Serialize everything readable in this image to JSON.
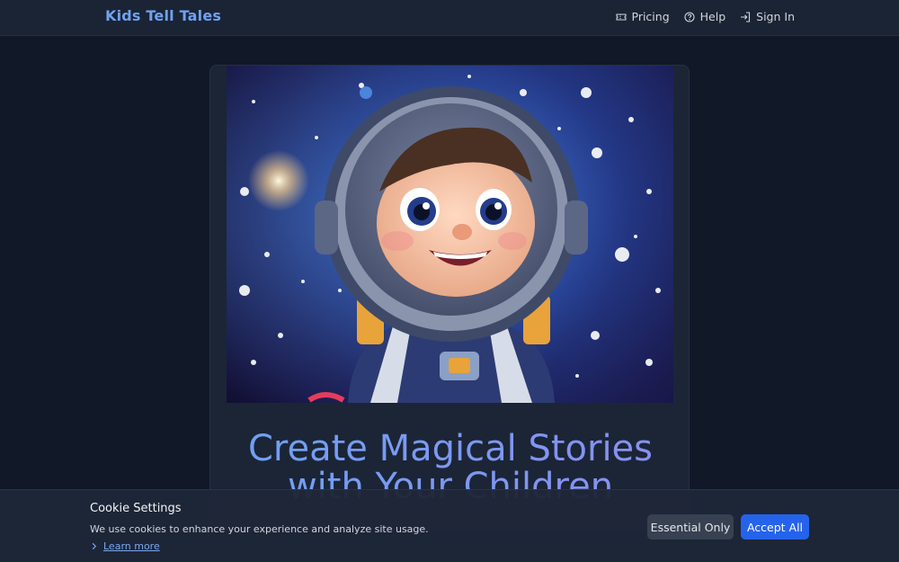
{
  "app": {
    "brand": "Kids Tell Tales"
  },
  "nav": {
    "items": [
      {
        "label": "Pricing",
        "icon": "ticket-icon"
      },
      {
        "label": "Help",
        "icon": "help-circle-icon"
      },
      {
        "label": "Sign In",
        "icon": "sign-in-icon"
      }
    ]
  },
  "hero": {
    "image_subject": "astronaut-child-in-space",
    "headline": "Create Magical Stories with Your Children"
  },
  "cookie": {
    "title": "Cookie Settings",
    "text": "We use cookies to enhance your experience and analyze site usage.",
    "learn_more": "Learn more",
    "essential_label": "Essential Only",
    "accept_label": "Accept All"
  },
  "colors": {
    "background": "#111827",
    "accent": "#6ea2f3",
    "primary_button": "#2563eb",
    "secondary_button": "#374151"
  }
}
